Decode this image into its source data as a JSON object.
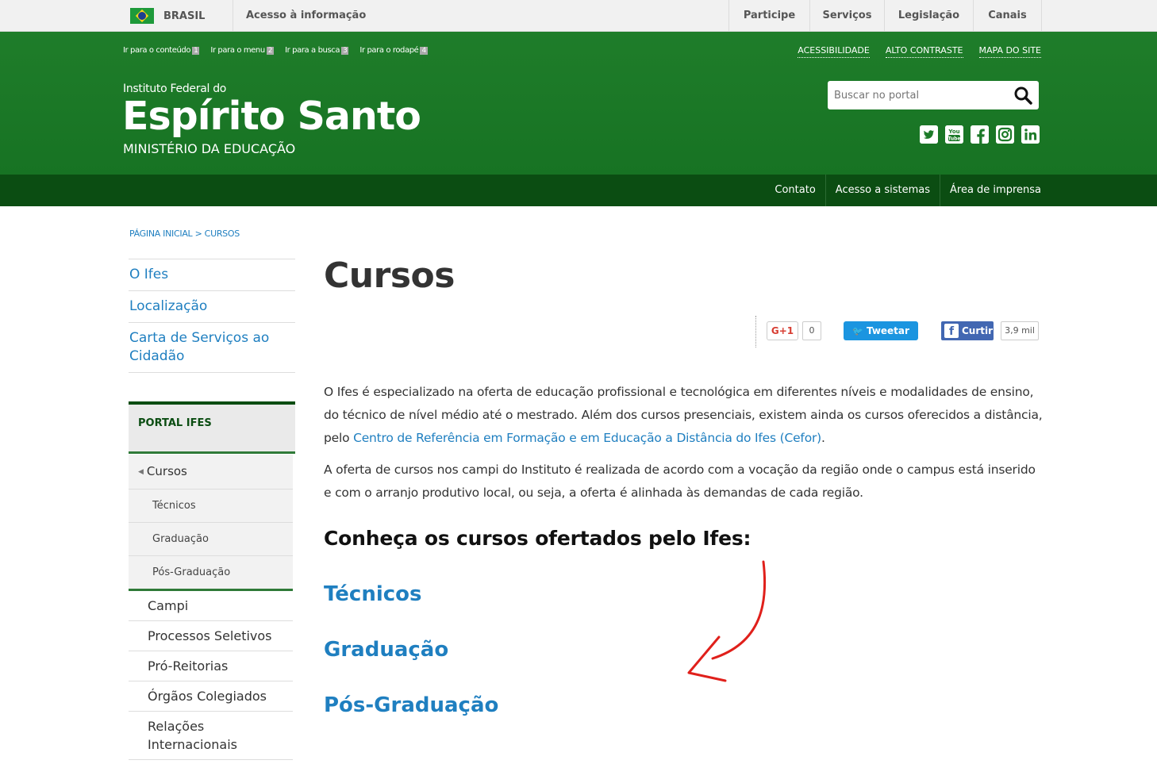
{
  "gov_bar": {
    "country": "BRASIL",
    "info_access": "Acesso à informação",
    "menu": [
      "Participe",
      "Serviços",
      "Legislação",
      "Canais"
    ]
  },
  "skip_links": [
    {
      "label": "Ir para o conteúdo",
      "key": "1"
    },
    {
      "label": "Ir para o menu",
      "key": "2"
    },
    {
      "label": "Ir para a busca",
      "key": "3"
    },
    {
      "label": "Ir para o rodapé",
      "key": "4"
    }
  ],
  "access_links": [
    "ACESSIBILIDADE",
    "ALTO CONTRASTE",
    "MAPA DO SITE"
  ],
  "brand": {
    "small": "Instituto Federal do",
    "big": "Espírito Santo",
    "ministry": "MINISTÉRIO DA EDUCAÇÃO"
  },
  "search": {
    "placeholder": "Buscar no portal"
  },
  "social_icons": [
    "twitter-icon",
    "youtube-icon",
    "facebook-icon",
    "instagram-icon",
    "linkedin-icon"
  ],
  "subnav": [
    "Contato",
    "Acesso a sistemas",
    "Área de imprensa"
  ],
  "breadcrumb": "PÁGINA INICIAL > CURSOS",
  "sidebar": {
    "top_links": [
      "O Ifes",
      "Localização",
      "Carta de Serviços ao Cidadão"
    ],
    "portal_title": "PORTAL IFES",
    "active": "Cursos",
    "sub_items": [
      "Técnicos",
      "Graduação",
      "Pós-Graduação"
    ],
    "items": [
      "Campi",
      "Processos Seletivos",
      "Pró-Reitorias",
      "Órgãos Colegiados",
      "Relações Internacionais"
    ]
  },
  "main": {
    "title": "Cursos",
    "share": {
      "gplus_label": "G+1",
      "gplus_count": "0",
      "tweet_label": "Tweetar",
      "fb_label": "Curtir",
      "fb_count": "3,9 mil"
    },
    "p1_text": "O Ifes é especializado na oferta de educação profissional e tecnológica em diferentes níveis e modalidades de ensino, do técnico de nível médio até o mestrado. Além dos cursos presenciais, existem ainda os cursos oferecidos a distância, pelo ",
    "p1_link": "Centro de Referência em Formação e em Educação a Distância do Ifes (Cefor)",
    "p1_end": ".",
    "p2_text": "A oferta de cursos nos campi do Instituto é realizada de acordo com a vocação da região onde o campus está inserido e com o arranjo produtivo local, ou seja, a oferta é alinhada às demandas de cada região.",
    "heading": "Conheça os cursos ofertados pelo Ifes:",
    "course_links": [
      "Técnicos",
      "Graduação",
      "Pós-Graduação"
    ]
  },
  "colors": {
    "header_green": "#1f7d2a",
    "nav_dark_green": "#0b4d12",
    "link_blue": "#1f7fc0",
    "annotation_red": "#e0201b"
  }
}
